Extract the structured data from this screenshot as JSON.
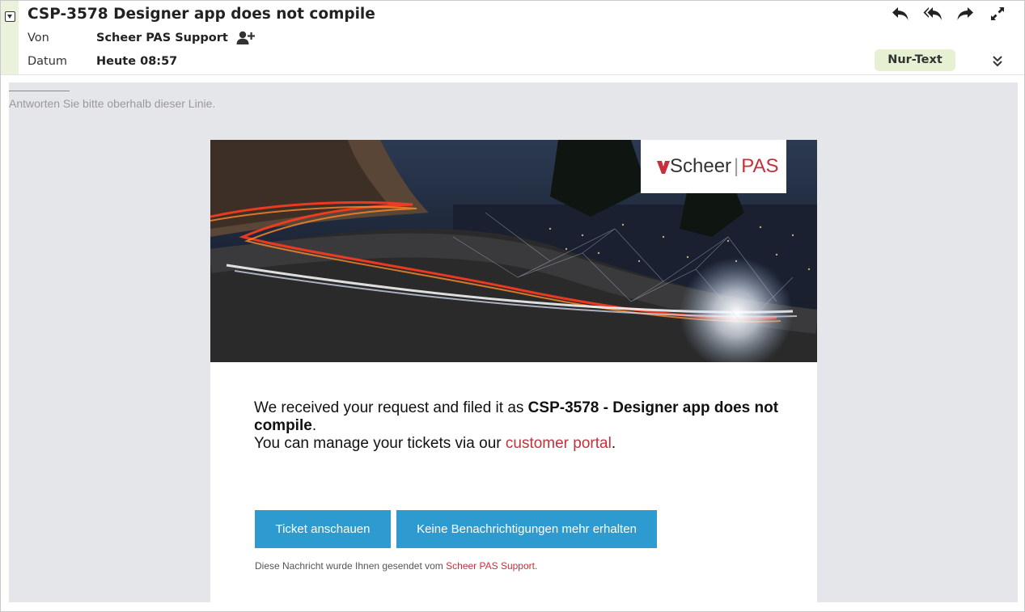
{
  "header": {
    "subject": "CSP-3578 Designer app does not compile",
    "from_label": "Von",
    "from_value": "Scheer PAS Support",
    "date_label": "Datum",
    "date_value": "Heute 08:57",
    "plaintext_label": "Nur-Text",
    "actions": [
      "reply-icon",
      "reply-all-icon",
      "forward-icon",
      "expand-icon"
    ]
  },
  "body": {
    "reply_hint": "Antworten Sie bitte oberhalb dieser Linie.",
    "logo": {
      "brand": "Scheer",
      "separator": "|",
      "product": "PAS"
    },
    "message": {
      "intro": "We received your request and filed it as ",
      "ticket": "CSP-3578 - Designer app does not compile",
      "after_ticket": ".",
      "manage": "You can manage your tickets via our ",
      "portal_link": "customer portal",
      "end": "."
    },
    "buttons": {
      "view_ticket": "Ticket anschauen",
      "unsubscribe": "Keine Benachrichtigungen mehr erhalten"
    },
    "footer": {
      "text": "Diese Nachricht wurde Ihnen gesendet vom ",
      "link": "Scheer PAS Support",
      "end": "."
    }
  },
  "colors": {
    "accent_link": "#c5303c",
    "button_bg": "#2d9ad0",
    "plaintext_bg": "#e6f0d3",
    "body_bg": "#e5e6ea"
  }
}
